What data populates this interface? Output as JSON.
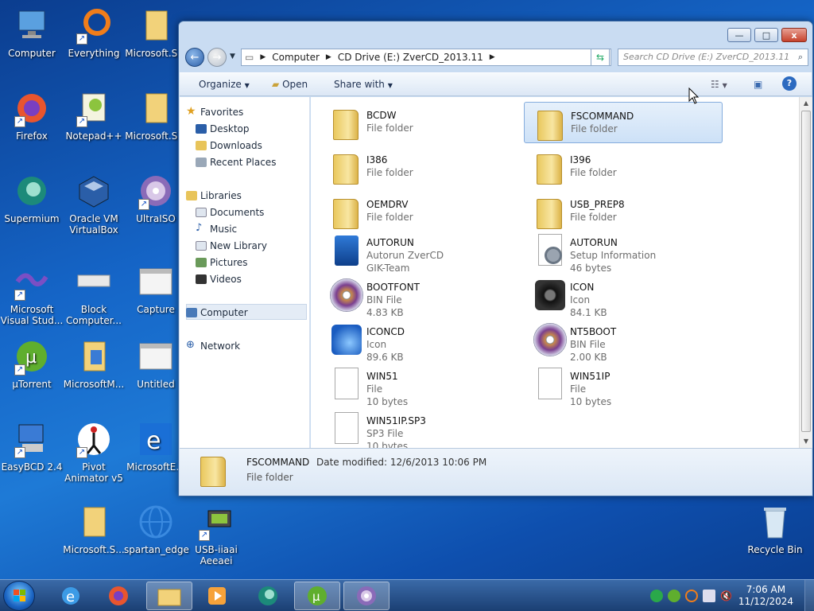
{
  "desktop": {
    "icons": [
      {
        "label": "Computer"
      },
      {
        "label": "Everything"
      },
      {
        "label": "Microsoft.S..."
      },
      {
        "label": "Firefox"
      },
      {
        "label": "Notepad++"
      },
      {
        "label": "Microsoft.S..."
      },
      {
        "label": "Supermium"
      },
      {
        "label": "Oracle VM VirtualBox"
      },
      {
        "label": "UltraISO"
      },
      {
        "label": "Microsoft Visual Stud..."
      },
      {
        "label": "Block Computer..."
      },
      {
        "label": "Capture"
      },
      {
        "label": "µTorrent"
      },
      {
        "label": "MicrosoftM..."
      },
      {
        "label": "Untitled"
      },
      {
        "label": "EasyBCD 2.4"
      },
      {
        "label": "Pivot Animator v5"
      },
      {
        "label": "MicrosoftE..."
      },
      {
        "label": "Microsoft.S..."
      },
      {
        "label": "spartan_edge"
      },
      {
        "label": "USB-iiaai Aeeaei"
      },
      {
        "label": "Recycle Bin"
      }
    ]
  },
  "explorer": {
    "window_buttons": {
      "minimize": "—",
      "maximize": "□",
      "close": "x"
    },
    "address": {
      "parts": [
        "Computer",
        "CD Drive (E:) ZverCD_2013.11"
      ]
    },
    "search": {
      "placeholder": "Search CD Drive (E:) ZverCD_2013.11"
    },
    "toolbar": {
      "organize": "Organize",
      "open": "Open",
      "share_with": "Share with"
    },
    "nav": {
      "favorites": "Favorites",
      "desktop": "Desktop",
      "downloads": "Downloads",
      "recent_places": "Recent Places",
      "libraries": "Libraries",
      "documents": "Documents",
      "music": "Music",
      "new_library": "New Library",
      "pictures": "Pictures",
      "videos": "Videos",
      "computer": "Computer",
      "network": "Network"
    },
    "files": [
      {
        "name": "BCDW",
        "type": "File folder",
        "size": ""
      },
      {
        "name": "FSCOMMAND",
        "type": "File folder",
        "size": ""
      },
      {
        "name": "I386",
        "type": "File folder",
        "size": ""
      },
      {
        "name": "I396",
        "type": "File folder",
        "size": ""
      },
      {
        "name": "OEMDRV",
        "type": "File folder",
        "size": ""
      },
      {
        "name": "USB_PREP8",
        "type": "File folder",
        "size": ""
      },
      {
        "name": "AUTORUN",
        "type": "Autorun ZverCD",
        "size": "GIK-Team"
      },
      {
        "name": "AUTORUN",
        "type": "Setup Information",
        "size": "46 bytes"
      },
      {
        "name": "BOOTFONT",
        "type": "BIN File",
        "size": "4.83 KB"
      },
      {
        "name": "ICON",
        "type": "Icon",
        "size": "84.1 KB"
      },
      {
        "name": "ICONCD",
        "type": "Icon",
        "size": "89.6 KB"
      },
      {
        "name": "NT5BOOT",
        "type": "BIN File",
        "size": "2.00 KB"
      },
      {
        "name": "WIN51",
        "type": "File",
        "size": "10 bytes"
      },
      {
        "name": "WIN51IP",
        "type": "File",
        "size": "10 bytes"
      },
      {
        "name": "WIN51IP.SP3",
        "type": "SP3 File",
        "size": "10 bytes"
      }
    ],
    "details": {
      "name": "FSCOMMAND",
      "date_label": "Date modified: 12/6/2013 10:06 PM",
      "type": "File folder"
    }
  },
  "taskbar": {
    "time": "7:06 AM",
    "date": "11/12/2024"
  }
}
